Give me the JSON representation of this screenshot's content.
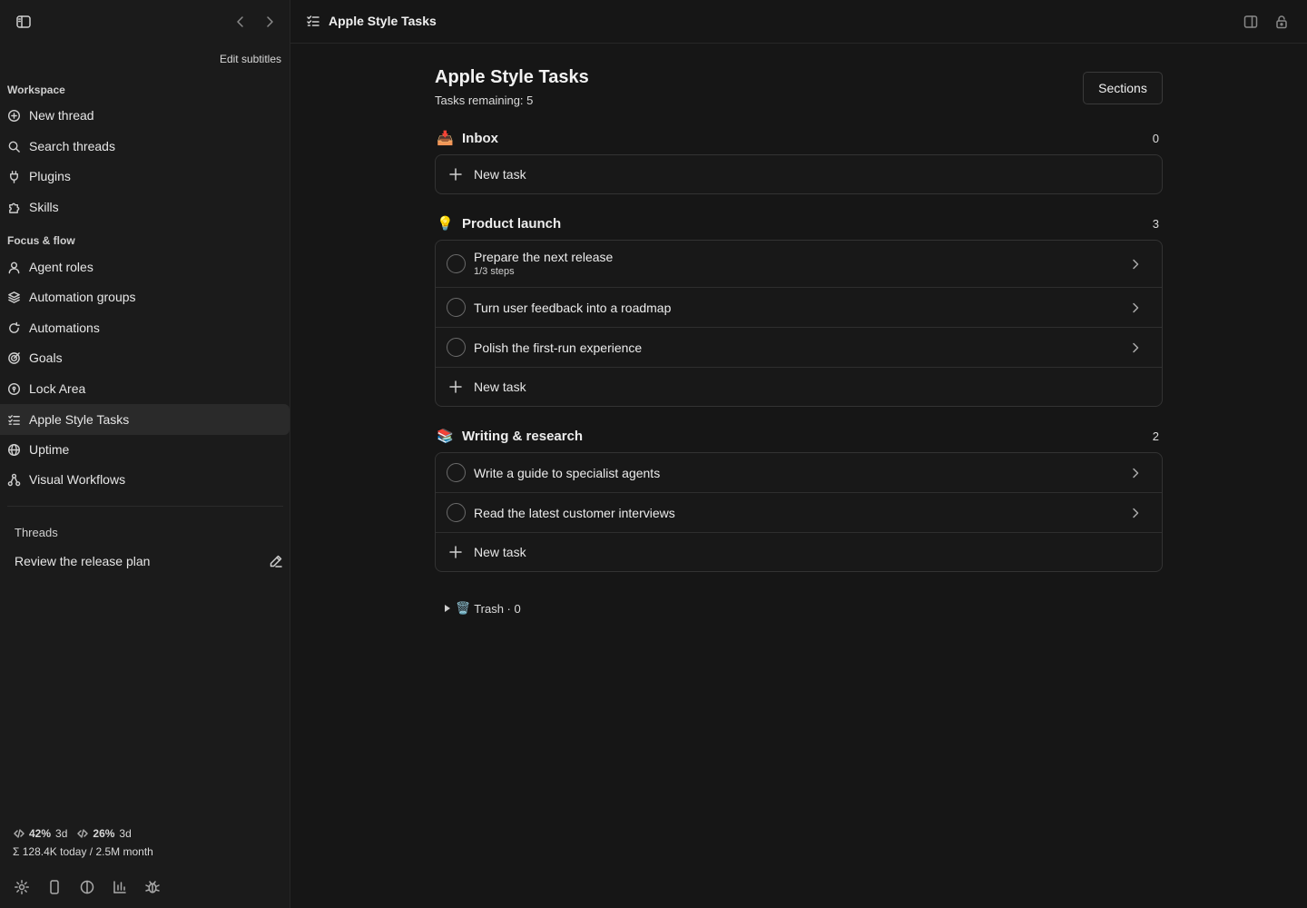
{
  "sidebar": {
    "edit_subtitles": "Edit subtitles",
    "workspace_label": "Workspace",
    "workspace_items": [
      {
        "label": "New thread",
        "icon": "plus-circle-icon"
      },
      {
        "label": "Search threads",
        "icon": "search-icon"
      },
      {
        "label": "Plugins",
        "icon": "plug-icon"
      },
      {
        "label": "Skills",
        "icon": "puzzle-icon"
      }
    ],
    "focus_label": "Focus & flow",
    "focus_items": [
      {
        "label": "Agent roles",
        "icon": "user-icon"
      },
      {
        "label": "Automation groups",
        "icon": "layers-icon"
      },
      {
        "label": "Automations",
        "icon": "loop-icon"
      },
      {
        "label": "Goals",
        "icon": "target-icon"
      },
      {
        "label": "Lock Area",
        "icon": "lock-circle-icon"
      },
      {
        "label": "Apple Style Tasks",
        "icon": "checklist-icon",
        "active": true
      },
      {
        "label": "Uptime",
        "icon": "globe-icon"
      },
      {
        "label": "Visual Workflows",
        "icon": "workflow-icon"
      }
    ],
    "threads_label": "Threads",
    "threads": [
      {
        "label": "Review the release plan"
      }
    ],
    "usage": {
      "a_pct": "42%",
      "a_period": "3d",
      "b_pct": "26%",
      "b_period": "3d",
      "tokens": "Σ 128.4K today / 2.5M month"
    }
  },
  "header": {
    "title": "Apple Style Tasks"
  },
  "main": {
    "title": "Apple Style Tasks",
    "tasks_remaining": "Tasks remaining: 5",
    "sections_button": "Sections",
    "new_task_label": "New task",
    "sections": [
      {
        "emoji": "📥",
        "name": "Inbox",
        "count": "0",
        "tasks": []
      },
      {
        "emoji": "💡",
        "name": "Product launch",
        "count": "3",
        "tasks": [
          {
            "title": "Prepare the next release",
            "subtitle": "1/3 steps"
          },
          {
            "title": "Turn user feedback into a roadmap"
          },
          {
            "title": "Polish the first-run experience"
          }
        ]
      },
      {
        "emoji": "📚",
        "name": "Writing & research",
        "count": "2",
        "tasks": [
          {
            "title": "Write a guide to specialist agents"
          },
          {
            "title": "Read the latest customer interviews"
          }
        ]
      }
    ],
    "trash_emoji": "🗑️",
    "trash_label": "Trash · 0"
  }
}
